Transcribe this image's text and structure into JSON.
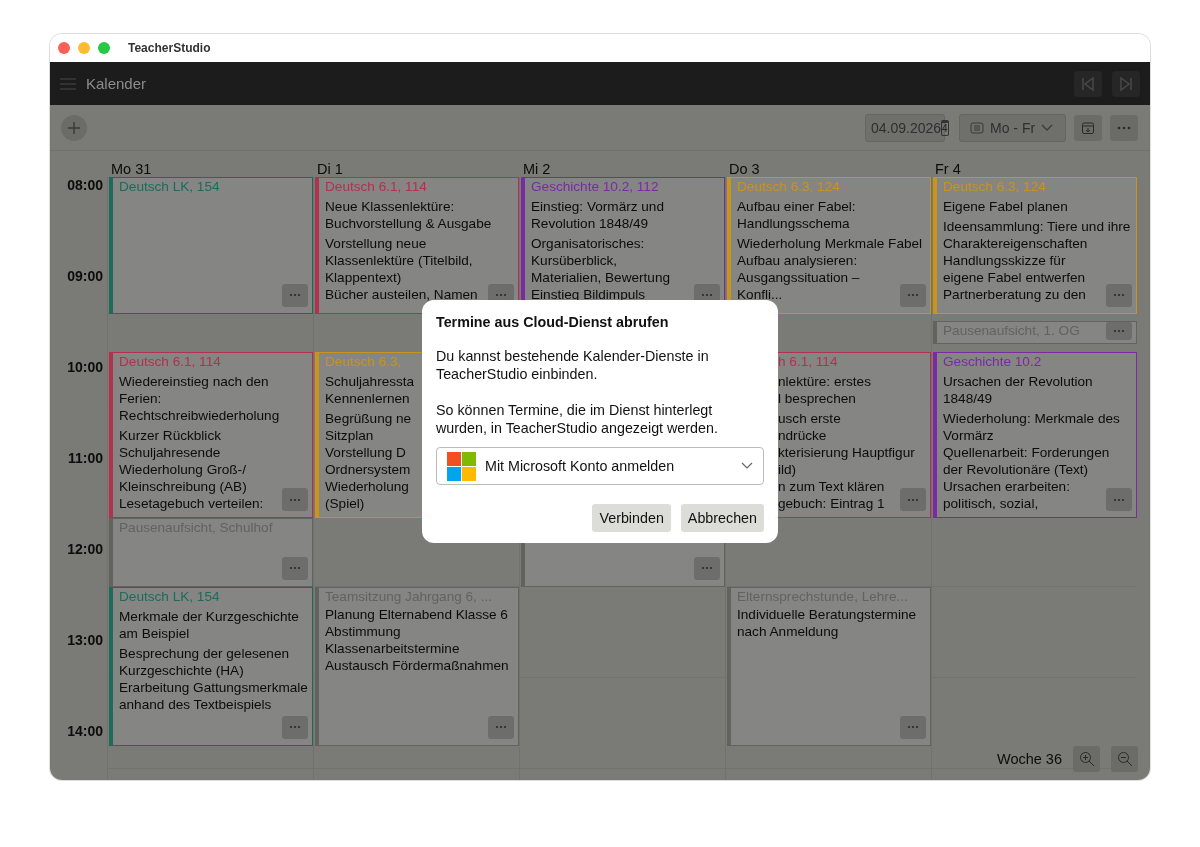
{
  "window": {
    "title": "TeacherStudio"
  },
  "header": {
    "title": "Kalender"
  },
  "toolbar": {
    "date": "04.09.2026",
    "date_icon_day": "4",
    "range": "Mo - Fr"
  },
  "hours": [
    "08:00",
    "09:00",
    "10:00",
    "11:00",
    "12:00",
    "13:00",
    "14:00"
  ],
  "days": [
    {
      "label": "Mo 31",
      "events": [
        {
          "kind": "card",
          "color": "#1d6b5b",
          "title": "Deutsch LK, 154"
        },
        {
          "kind": "card",
          "color": "#b3304f",
          "title": "Deutsch 6.1, 114",
          "topic": [
            "Wiedereinstieg nach den Ferien: Rechtschreibwiederholung"
          ],
          "notes": [
            "Kurzer Rückblick Schuljahresende",
            "Wiederholung Groß-/ Kleinschreibung (AB)",
            "Lesetagebuch verteilen:"
          ]
        },
        {
          "kind": "card",
          "color": "#62625f",
          "title": "Pausenaufsicht, Schulhof"
        },
        {
          "kind": "card",
          "color": "#1d6b5b",
          "title": "Deutsch LK, 154",
          "topic": [
            "Merkmale der Kurzgeschichte am Beispiel"
          ],
          "notes": [
            "Besprechung der gelesenen Kurzgeschichte (HA)",
            "Erarbeitung Gattungsmerkmale anhand des Textbeispiels"
          ]
        }
      ]
    },
    {
      "label": "Di 1",
      "events": [
        {
          "kind": "card",
          "color": "#b3304f",
          "title": "Deutsch 6.1, 114",
          "topic": [
            "Neue Klassenlektüre: Buchvorstellung & Ausgabe"
          ],
          "notes": [
            "Vorstellung neue Klassenlektüre (Titelbild, Klappentext)",
            "Bücher austeilen, Namen"
          ]
        },
        {
          "kind": "cut_right",
          "color": "#c8941c",
          "title": "Deutsch 6.3,",
          "topic": [
            "Schuljahressta",
            "Kennenlernen"
          ],
          "notes": [
            "Begrüßung ne",
            "Sitzplan",
            "Vorstellung D",
            "Ordnersystem",
            "Wiederholung",
            "(Spiel)"
          ]
        },
        {
          "kind": "card",
          "color": "#62625f",
          "title": "Teamsitzung Jahrgang 6, ...",
          "notes": [
            "Planung Elternabend Klasse 6",
            "Abstimmung Klassenarbeitstermine",
            "Austausch Fördermaßnahmen"
          ]
        }
      ]
    },
    {
      "label": "Mi 2",
      "events": [
        {
          "kind": "card",
          "color": "#7a2aa3",
          "title": "Geschichte 10.2, 112",
          "topic": [
            "Einstieg: Vormärz und Revolution 1848/49"
          ],
          "notes": [
            "Organisatorisches: Kursüberblick, Materialien, Bewertung",
            "Einstieg Bildimpuls"
          ]
        },
        {
          "kind": "covered",
          "color": "#62625f"
        }
      ]
    },
    {
      "label": "Do 3",
      "events": [
        {
          "kind": "card",
          "color": "#c8941c",
          "title": "Deutsch 6.3, 124",
          "topic": [
            "Aufbau einer Fabel: Handlungsschema"
          ],
          "notes": [
            "Wiederholung Merkmale Fabel",
            "Aufbau analysieren: Ausgangssituation – Konfli..."
          ]
        },
        {
          "kind": "cut_left",
          "color": "#b3304f",
          "title": "h 6.1, 114",
          "topic": [
            "nlektüre: erstes",
            "l besprechen"
          ],
          "notes": [
            "usch erste",
            "ndrücke",
            "kterisierung Hauptfigur",
            "ild)",
            "n zum Text klären",
            "gebuch: Eintrag 1"
          ]
        },
        {
          "kind": "card",
          "color": "#62625f",
          "title": "Elternsprechstunde, Lehre...",
          "notes": [
            "Individuelle Beratungstermine nach Anmeldung"
          ]
        }
      ]
    },
    {
      "label": "Fr 4",
      "events": [
        {
          "kind": "card",
          "color": "#c8941c",
          "title": "Deutsch 6.3, 124",
          "topic": [
            "Eigene Fabel planen"
          ],
          "notes": [
            "Ideensammlung: Tiere und ihre Charaktereigenschaften",
            "Handlungsskizze für eigene Fabel entwerfen",
            "Partnerberatung zu den"
          ]
        },
        {
          "kind": "card",
          "color": "#62625f",
          "title": "Pausenaufsicht, 1. OG"
        },
        {
          "kind": "card",
          "color": "#7a2aa3",
          "title": "Geschichte 10.2",
          "topic": [
            "Ursachen der Revolution 1848/49"
          ],
          "notes": [
            "Wiederholung: Merkmale des Vormärz",
            "Quellenarbeit: Forderungen der Revolutionäre (Text)",
            "Ursachen erarbeiten: politisch, sozial,"
          ]
        }
      ]
    }
  ],
  "week_label": "Woche 36",
  "dialog": {
    "title": "Termine aus Cloud-Dienst abrufen",
    "paragraphs": [
      "Du kannst bestehende Kalender-Dienste in TeacherStudio einbinden.",
      "So können Termine, die im Dienst hinterlegt wurden, in TeacherStudio angezeigt werden."
    ],
    "provider": "Mit Microsoft Konto anmelden",
    "buttons": [
      "Verbinden",
      "Abbrechen"
    ]
  }
}
